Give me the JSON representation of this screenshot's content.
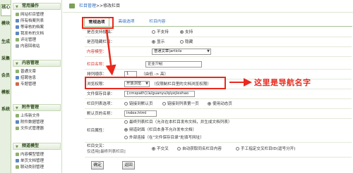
{
  "vtabs": [
    "核心",
    "模块",
    "生成",
    "采集",
    "会员",
    "模板",
    "系统"
  ],
  "sidebar": {
    "sections": [
      {
        "title": "常用操作",
        "items": [
          {
            "label": "网站栏目管理",
            "icon": "tree-icon"
          },
          {
            "label": "所有档案列表",
            "icon": "doc-icon"
          },
          {
            "label": "等审核的档案",
            "icon": "doc-icon"
          },
          {
            "label": "我发布的文档",
            "icon": "doc-icon"
          },
          {
            "label": "评论管理",
            "icon": "comment-icon"
          },
          {
            "label": "内容回收站",
            "icon": "trash-icon"
          }
        ]
      },
      {
        "title": "内容管理",
        "items": [
          {
            "label": "普通文章",
            "icon": "article-icon"
          },
          {
            "label": "招聘信息",
            "icon": "job-icon"
          },
          {
            "label": "专题管理",
            "icon": "topic-icon"
          }
        ]
      },
      {
        "title": "附件管理",
        "items": [
          {
            "label": "上传新文件",
            "icon": "upload-icon"
          },
          {
            "label": "附件数据管理",
            "icon": "attach-icon"
          },
          {
            "label": "文件式管理器",
            "icon": "folder-icon"
          }
        ]
      },
      {
        "title": "频道模型",
        "items": [
          {
            "label": "内容模型管理",
            "icon": "model-icon"
          },
          {
            "label": "单页文档管理",
            "icon": "page-icon"
          },
          {
            "label": "联动类别管理",
            "icon": "link-icon"
          }
        ]
      }
    ],
    "extra_icons": [
      "+",
      "+"
    ]
  },
  "breadcrumb": {
    "part1": "栏目管理",
    "sep": ">>",
    "part2": "修改栏目"
  },
  "tabs": [
    "常规选项",
    "高级选项",
    "栏目内容"
  ],
  "form": {
    "support_submit": {
      "label": "是否支持投稿：",
      "opt1": "不支持",
      "opt2": "支持"
    },
    "hidden": {
      "label": "是否隐藏栏目：",
      "opt1": "显示",
      "opt2": "隐藏"
    },
    "content_model": {
      "label": "内容模型：",
      "value": "普通文章|article"
    },
    "column_name": {
      "label": "栏目名称：",
      "value": "企业介绍"
    },
    "sort_order": {
      "label": "排列顺序：",
      "value": "1",
      "hint": "（由低 -> 高）"
    },
    "browse_perm": {
      "label": "浏览权限：",
      "value": "开放浏览",
      "hint": "（仅限制栏目里的文档浏览权限）"
    },
    "save_dir": {
      "label": "文件保存目录：",
      "value": "{cmspath}/a/guanyu/qiyejieshao"
    },
    "list_option": {
      "label": "栏目列表选项：",
      "opt1": "链接到默认页",
      "opt2": "链接到列表第一页",
      "opt3": "使用动态页"
    },
    "default_page": {
      "label": "默认页的名称：",
      "value": "index.html"
    },
    "attribute": {
      "label": "栏目属性：",
      "opt1": "最终列表栏目（允许在本栏目发布文档，并生成文档列表）",
      "opt2": "频道封面（栏目本身不允许发布文档）",
      "opt3": "外部连接（在\"文件保存目录\"处填写网址）"
    },
    "cross": {
      "label1": "栏目交叉：",
      "label2": "仅适用[最终列表栏目]",
      "opt1": "不交叉",
      "opt2": "自动获取同名栏目内容",
      "opt3": "手工指定交叉栏目ID(逗号分开)"
    }
  },
  "buttons": {
    "ok": "确定",
    "back": "返回"
  },
  "annotation": {
    "text": "这里是导航名字",
    "color": "#e8291c"
  }
}
